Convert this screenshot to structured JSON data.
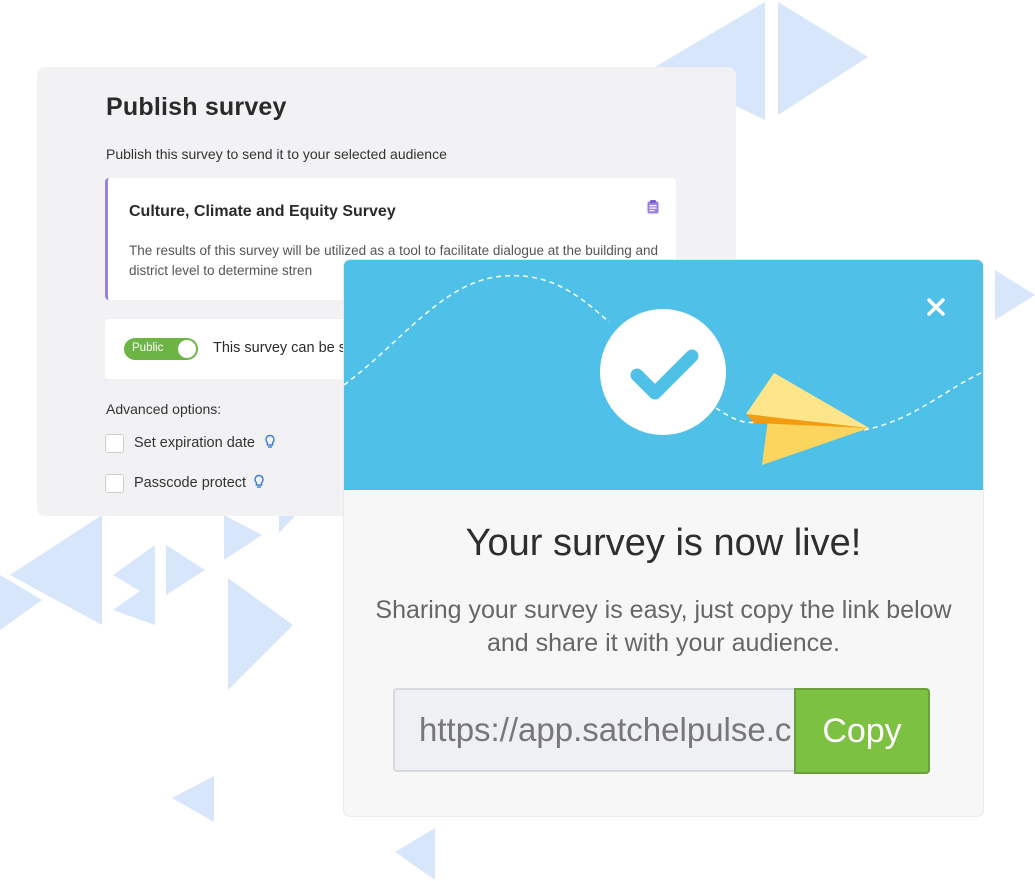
{
  "publish": {
    "title": "Publish survey",
    "description": "Publish this survey to send it to your selected audience",
    "survey": {
      "name": "Culture, Climate and Equity Survey",
      "text": "The results of this survey will be utilized as a tool to facilitate dialogue at the building and district level to determine stren"
    },
    "visibility": {
      "toggle_label": "Public",
      "toggle_on": true,
      "text": "This survey can be sh"
    },
    "advanced_label": "Advanced options:",
    "options": [
      {
        "label": "Set expiration date",
        "checked": false
      },
      {
        "label": "Passcode protect",
        "checked": false
      }
    ]
  },
  "modal": {
    "heading": "Your survey is now live!",
    "subtext": "Sharing your survey is easy, just copy the link below and share it with your audience.",
    "link_value": "https://app.satchelpulse.c",
    "copy_label": "Copy"
  },
  "colors": {
    "banner": "#4fc0e8",
    "copy_button": "#7dc142",
    "toggle": "#6cb443",
    "survey_accent": "#9b7fe6",
    "decor_triangles": "#d7e6fb"
  },
  "icons": {
    "close": "close-icon",
    "check": "check-icon",
    "plane": "paper-plane-icon",
    "clipboard": "clipboard-icon",
    "hint": "lightbulb-icon"
  }
}
